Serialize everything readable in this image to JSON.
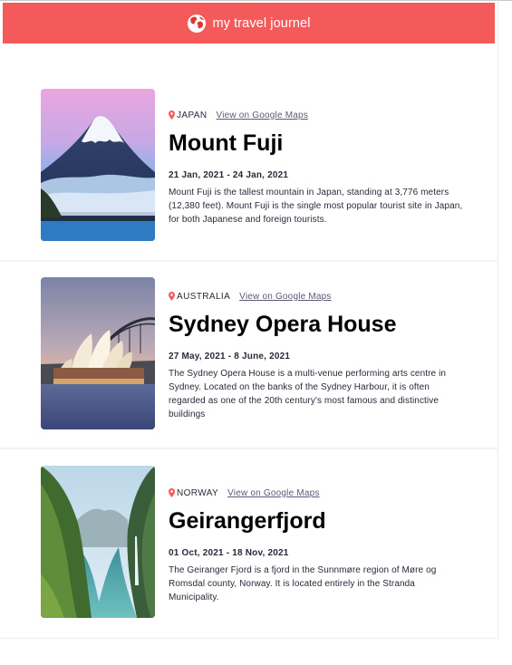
{
  "app": {
    "title": "my travel journel",
    "accent": "#F55A5A",
    "logo": "globe-icon"
  },
  "entries": [
    {
      "country": "JAPAN",
      "map_link": "View on Google Maps",
      "title": "Mount Fuji",
      "dates": "21 Jan, 2021 - 24 Jan, 2021",
      "description": "Mount Fuji is the tallest mountain in Japan, standing at 3,776 meters (12,380 feet). Mount Fuji is the single most popular tourist site in Japan, for both Japanese and foreign tourists."
    },
    {
      "country": "AUSTRALIA",
      "map_link": "View on Google Maps",
      "title": "Sydney Opera House",
      "dates": "27 May, 2021 - 8 June, 2021",
      "description": "The Sydney Opera House is a multi-venue performing arts centre in Sydney. Located on the banks of the Sydney Harbour, it is often regarded as one of the 20th century's most famous and distinctive buildings"
    },
    {
      "country": "NORWAY",
      "map_link": "View on Google Maps",
      "title": "Geirangerfjord",
      "dates": "01 Oct, 2021 - 18 Nov, 2021",
      "description": "The Geiranger Fjord is a fjord in the Sunnmøre region of Møre og Romsdal county, Norway. It is located entirely in the Stranda Municipality."
    }
  ]
}
